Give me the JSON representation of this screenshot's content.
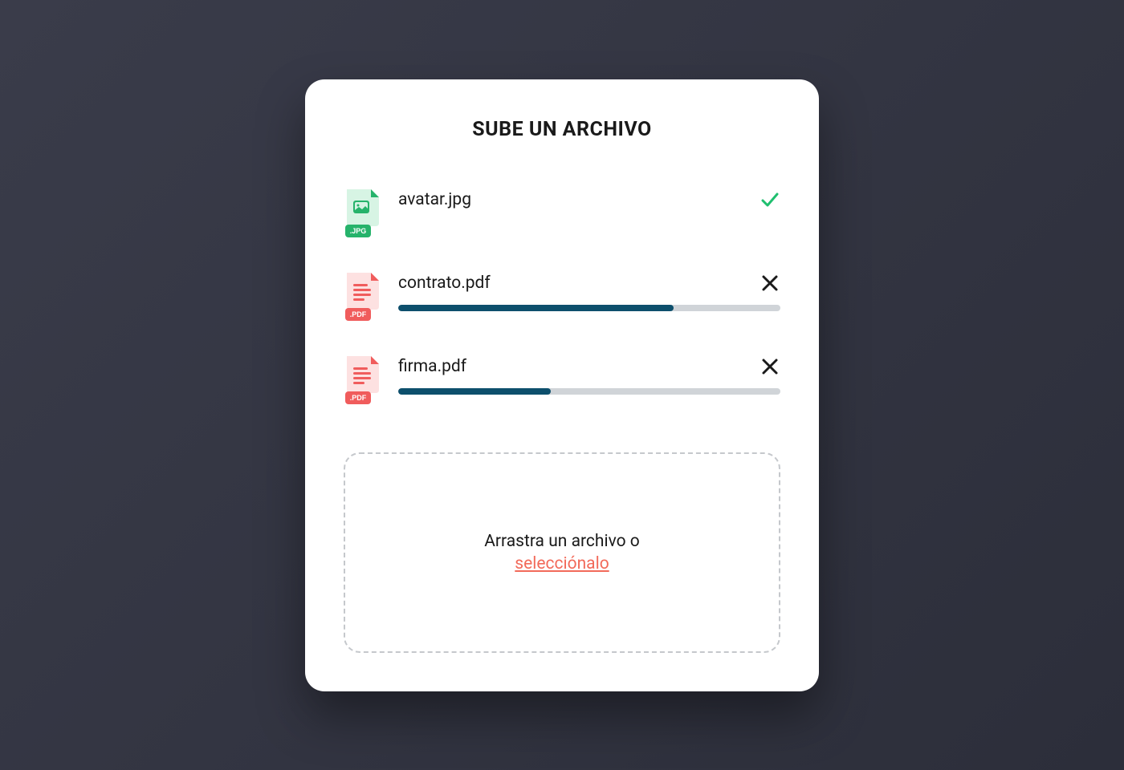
{
  "title": "SUBE UN ARCHIVO",
  "files": [
    {
      "type": "jpg",
      "name": "avatar.jpg",
      "status": "done",
      "progress": 100
    },
    {
      "type": "pdf",
      "name": "contrato.pdf",
      "status": "uploading",
      "progress": 72
    },
    {
      "type": "pdf",
      "name": "firma.pdf",
      "status": "uploading",
      "progress": 40
    }
  ],
  "dropzone": {
    "text": "Arrastra un archivo o",
    "link": "selecciónalo"
  },
  "colors": {
    "accent_green": "#26b36b",
    "accent_red": "#f05c5c",
    "progress_fill": "#0d4f6c",
    "progress_track": "#d0d4d8",
    "link": "#f26a5a",
    "check": "#1fbf6f"
  }
}
